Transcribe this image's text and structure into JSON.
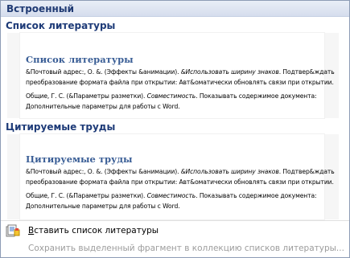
{
  "header": {
    "title": "Встроенный"
  },
  "items": [
    {
      "section_title": "Список литературы",
      "preview_heading": "Список литературы",
      "line1a": "&Почтовый адрес:, О. &. (Эффекты &анимации). ",
      "line1b": "&Использовать ширину знаков",
      "line1c": ". Подтвер&ждать",
      "line2": "преобразование формата файла при открытии: Авт&оматически обновлять связи при открытии.",
      "line3a": "Общие, Г. С. (&Параметры разметки). ",
      "line3b": "Совместимость",
      "line3c": ". Показывать содержимое документа:",
      "line4": "Дополнительные параметры для работы с Word."
    },
    {
      "section_title": "Цитируемые труды",
      "preview_heading": "Цитируемые труды",
      "line1a": "&Почтовый адрес:, О. &. (Эффекты &анимации). ",
      "line1b": "&Использовать ширину знаков",
      "line1c": ". Подтвер&ждать",
      "line2": "преобразование формата файла при открытии: Авт&оматически обновлять связи при открытии.",
      "line3a": "Общие, Г. С. (&Параметры разметки). ",
      "line3b": "Совместимость",
      "line3c": ". Показывать содержимое документа:",
      "line4": "Дополнительные параметры для работы с Word."
    }
  ],
  "commands": {
    "insert_label_accel": "В",
    "insert_label_rest": "ставить список литературы",
    "save_label": "Сохранить выделенный фрагмент в коллекцию списков литературы..."
  },
  "icons": {
    "insert": "bibliography-insert-icon"
  }
}
